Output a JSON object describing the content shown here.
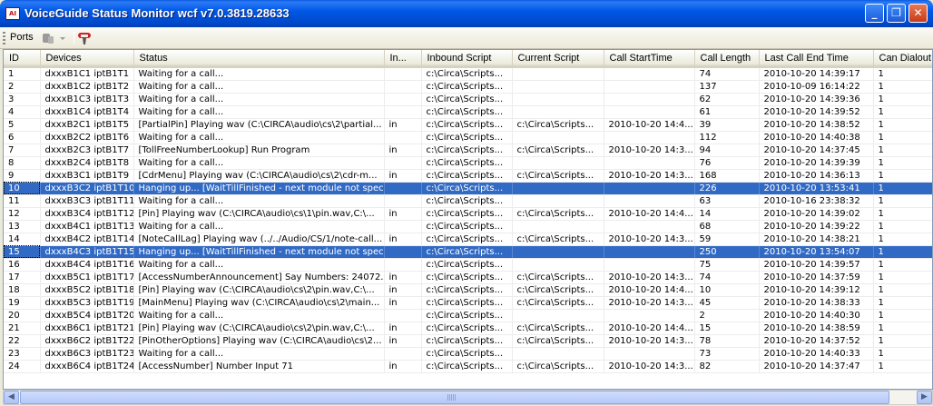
{
  "window": {
    "title": "VoiceGuide Status Monitor wcf v7.0.3819.28633",
    "icon_text": "AI",
    "controls": {
      "minimize": "_",
      "restore": "❐",
      "close": "✕"
    }
  },
  "toolbar": {
    "ports_label": "Ports"
  },
  "grid": {
    "columns": [
      "ID",
      "Devices",
      "Status",
      "In...",
      "Inbound Script",
      "Current Script",
      "Call StartTime",
      "Call Length",
      "Last Call End Time",
      "Can Dialout"
    ],
    "rows": [
      {
        "id": "1",
        "device": "dxxxB1C1 iptB1T1",
        "status": "Waiting for a call...",
        "in": "",
        "inbound": "c:\\Circa\\Scripts...",
        "current": "",
        "start": "",
        "length": "74",
        "lastend": "2010-10-20 14:39:17",
        "dialout": "1"
      },
      {
        "id": "2",
        "device": "dxxxB1C2 iptB1T2",
        "status": "Waiting for a call...",
        "in": "",
        "inbound": "c:\\Circa\\Scripts...",
        "current": "",
        "start": "",
        "length": "137",
        "lastend": "2010-10-09 16:14:22",
        "dialout": "1"
      },
      {
        "id": "3",
        "device": "dxxxB1C3 iptB1T3",
        "status": "Waiting for a call...",
        "in": "",
        "inbound": "c:\\Circa\\Scripts...",
        "current": "",
        "start": "",
        "length": "62",
        "lastend": "2010-10-20 14:39:36",
        "dialout": "1"
      },
      {
        "id": "4",
        "device": "dxxxB1C4 iptB1T4",
        "status": "Waiting for a call...",
        "in": "",
        "inbound": "c:\\Circa\\Scripts...",
        "current": "",
        "start": "",
        "length": "61",
        "lastend": "2010-10-20 14:39:52",
        "dialout": "1"
      },
      {
        "id": "5",
        "device": "dxxxB2C1 iptB1T5",
        "status": "[PartialPin] Playing wav (C:\\CIRCA\\audio\\cs\\2\\partial...",
        "in": "in",
        "inbound": "c:\\Circa\\Scripts...",
        "current": "c:\\Circa\\Scripts...",
        "start": "2010-10-20 14:4...",
        "length": "39",
        "lastend": "2010-10-20 14:38:52",
        "dialout": "1"
      },
      {
        "id": "6",
        "device": "dxxxB2C2 iptB1T6",
        "status": "Waiting for a call...",
        "in": "",
        "inbound": "c:\\Circa\\Scripts...",
        "current": "",
        "start": "",
        "length": "112",
        "lastend": "2010-10-20 14:40:38",
        "dialout": "1"
      },
      {
        "id": "7",
        "device": "dxxxB2C3 iptB1T7",
        "status": "[TollFreeNumberLookup] Run Program",
        "in": "in",
        "inbound": "c:\\Circa\\Scripts...",
        "current": "c:\\Circa\\Scripts...",
        "start": "2010-10-20 14:3...",
        "length": "94",
        "lastend": "2010-10-20 14:37:45",
        "dialout": "1"
      },
      {
        "id": "8",
        "device": "dxxxB2C4 iptB1T8",
        "status": "Waiting for a call...",
        "in": "",
        "inbound": "c:\\Circa\\Scripts...",
        "current": "",
        "start": "",
        "length": "76",
        "lastend": "2010-10-20 14:39:39",
        "dialout": "1"
      },
      {
        "id": "9",
        "device": "dxxxB3C1 iptB1T9",
        "status": "[CdrMenu] Playing wav (C:\\CIRCA\\audio\\cs\\2\\cdr-m...",
        "in": "in",
        "inbound": "c:\\Circa\\Scripts...",
        "current": "c:\\Circa\\Scripts...",
        "start": "2010-10-20 14:3...",
        "length": "168",
        "lastend": "2010-10-20 14:36:13",
        "dialout": "1"
      },
      {
        "id": "10",
        "device": "dxxxB3C2 iptB1T10",
        "status": "Hanging up... [WaitTillFinished - next module not spec...",
        "in": "",
        "inbound": "c:\\Circa\\Scripts...",
        "current": "",
        "start": "",
        "length": "226",
        "lastend": "2010-10-20 13:53:41",
        "dialout": "1",
        "selected": true
      },
      {
        "id": "11",
        "device": "dxxxB3C3 iptB1T11",
        "status": "Waiting for a call...",
        "in": "",
        "inbound": "c:\\Circa\\Scripts...",
        "current": "",
        "start": "",
        "length": "63",
        "lastend": "2010-10-16 23:38:32",
        "dialout": "1"
      },
      {
        "id": "12",
        "device": "dxxxB3C4 iptB1T12",
        "status": "[Pin] Playing wav (C:\\CIRCA\\audio\\cs\\1\\pin.wav,C:\\...",
        "in": "in",
        "inbound": "c:\\Circa\\Scripts...",
        "current": "c:\\Circa\\Scripts...",
        "start": "2010-10-20 14:4...",
        "length": "14",
        "lastend": "2010-10-20 14:39:02",
        "dialout": "1"
      },
      {
        "id": "13",
        "device": "dxxxB4C1 iptB1T13",
        "status": "Waiting for a call...",
        "in": "",
        "inbound": "c:\\Circa\\Scripts...",
        "current": "",
        "start": "",
        "length": "68",
        "lastend": "2010-10-20 14:39:22",
        "dialout": "1"
      },
      {
        "id": "14",
        "device": "dxxxB4C2 iptB1T14",
        "status": "[NoteCallLag] Playing wav (../../Audio/CS/1/note-call...",
        "in": "in",
        "inbound": "c:\\Circa\\Scripts...",
        "current": "c:\\Circa\\Scripts...",
        "start": "2010-10-20 14:3...",
        "length": "59",
        "lastend": "2010-10-20 14:38:21",
        "dialout": "1"
      },
      {
        "id": "15",
        "device": "dxxxB4C3 iptB1T15",
        "status": "Hanging up... [WaitTillFinished - next module not spec...",
        "in": "",
        "inbound": "c:\\Circa\\Scripts...",
        "current": "",
        "start": "",
        "length": "250",
        "lastend": "2010-10-20 13:54:07",
        "dialout": "1",
        "selected": true
      },
      {
        "id": "16",
        "device": "dxxxB4C4 iptB1T16",
        "status": "Waiting for a call...",
        "in": "",
        "inbound": "c:\\Circa\\Scripts...",
        "current": "",
        "start": "",
        "length": "75",
        "lastend": "2010-10-20 14:39:57",
        "dialout": "1"
      },
      {
        "id": "17",
        "device": "dxxxB5C1 iptB1T17",
        "status": "[AccessNumberAnnouncement] Say Numbers: 24072...",
        "in": "in",
        "inbound": "c:\\Circa\\Scripts...",
        "current": "c:\\Circa\\Scripts...",
        "start": "2010-10-20 14:3...",
        "length": "74",
        "lastend": "2010-10-20 14:37:59",
        "dialout": "1"
      },
      {
        "id": "18",
        "device": "dxxxB5C2 iptB1T18",
        "status": "[Pin] Playing wav (C:\\CIRCA\\audio\\cs\\2\\pin.wav,C:\\...",
        "in": "in",
        "inbound": "c:\\Circa\\Scripts...",
        "current": "c:\\Circa\\Scripts...",
        "start": "2010-10-20 14:4...",
        "length": "10",
        "lastend": "2010-10-20 14:39:12",
        "dialout": "1"
      },
      {
        "id": "19",
        "device": "dxxxB5C3 iptB1T19",
        "status": "[MainMenu] Playing wav (C:\\CIRCA\\audio\\cs\\2\\main...",
        "in": "in",
        "inbound": "c:\\Circa\\Scripts...",
        "current": "c:\\Circa\\Scripts...",
        "start": "2010-10-20 14:3...",
        "length": "45",
        "lastend": "2010-10-20 14:38:33",
        "dialout": "1"
      },
      {
        "id": "20",
        "device": "dxxxB5C4 iptB1T20",
        "status": "Waiting for a call...",
        "in": "",
        "inbound": "c:\\Circa\\Scripts...",
        "current": "",
        "start": "",
        "length": "2",
        "lastend": "2010-10-20 14:40:30",
        "dialout": "1"
      },
      {
        "id": "21",
        "device": "dxxxB6C1 iptB1T21",
        "status": "[Pin] Playing wav (C:\\CIRCA\\audio\\cs\\2\\pin.wav,C:\\...",
        "in": "in",
        "inbound": "c:\\Circa\\Scripts...",
        "current": "c:\\Circa\\Scripts...",
        "start": "2010-10-20 14:4...",
        "length": "15",
        "lastend": "2010-10-20 14:38:59",
        "dialout": "1"
      },
      {
        "id": "22",
        "device": "dxxxB6C2 iptB1T22",
        "status": "[PinOtherOptions] Playing wav (C:\\CIRCA\\audio\\cs\\2...",
        "in": "in",
        "inbound": "c:\\Circa\\Scripts...",
        "current": "c:\\Circa\\Scripts...",
        "start": "2010-10-20 14:3...",
        "length": "78",
        "lastend": "2010-10-20 14:37:52",
        "dialout": "1"
      },
      {
        "id": "23",
        "device": "dxxxB6C3 iptB1T23",
        "status": "Waiting for a call...",
        "in": "",
        "inbound": "c:\\Circa\\Scripts...",
        "current": "",
        "start": "",
        "length": "73",
        "lastend": "2010-10-20 14:40:33",
        "dialout": "1"
      },
      {
        "id": "24",
        "device": "dxxxB6C4 iptB1T24",
        "status": "[AccessNumber] Number Input 71",
        "in": "in",
        "inbound": "c:\\Circa\\Scripts...",
        "current": "c:\\Circa\\Scripts...",
        "start": "2010-10-20 14:3...",
        "length": "82",
        "lastend": "2010-10-20 14:37:47",
        "dialout": "1"
      }
    ]
  },
  "scrollbar": {
    "left_arrow": "◀",
    "right_arrow": "▶"
  }
}
